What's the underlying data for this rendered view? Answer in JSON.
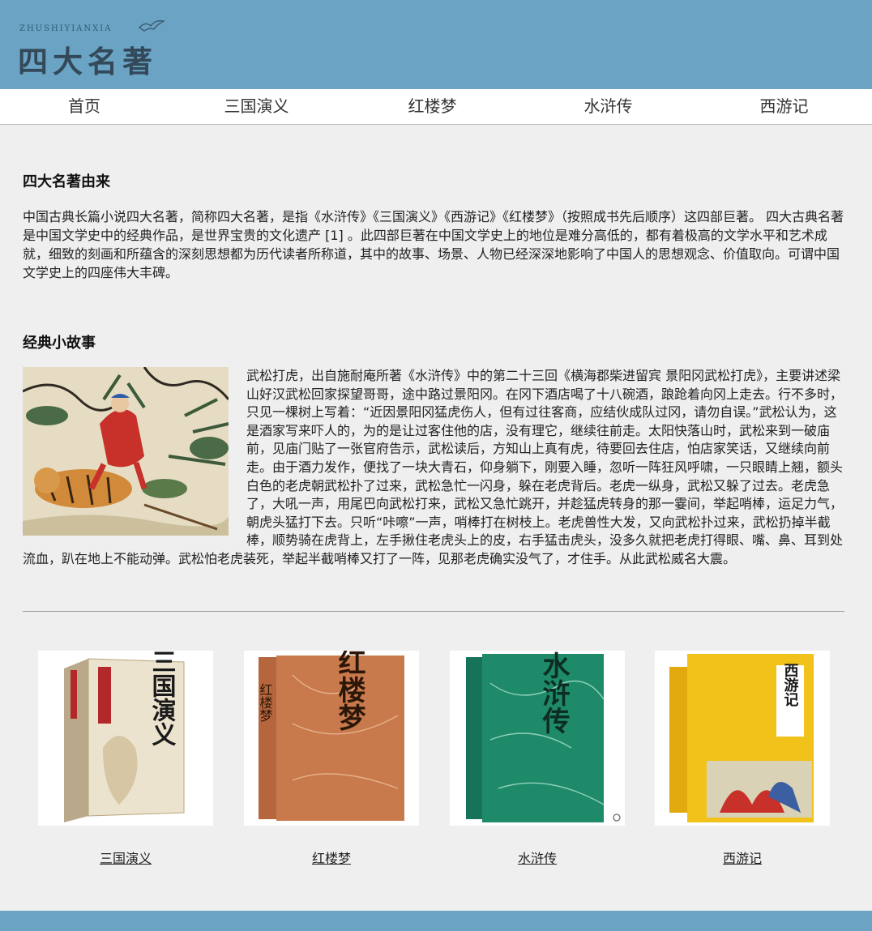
{
  "header": {
    "logo_sub": "ZHUSHIYIANXIA",
    "logo_title": "四大名著"
  },
  "nav": [
    {
      "label": "首页"
    },
    {
      "label": "三国演义"
    },
    {
      "label": "红楼梦"
    },
    {
      "label": "水浒传"
    },
    {
      "label": "西游记"
    }
  ],
  "intro": {
    "title": "四大名著由来",
    "text": "中国古典长篇小说四大名著，简称四大名著，是指《水浒传》《三国演义》《西游记》《红楼梦》（按照成书先后顺序）这四部巨著。 四大古典名著是中国文学史中的经典作品，是世界宝贵的文化遗产 [1] 。此四部巨著在中国文学史上的地位是难分高低的，都有着极高的文学水平和艺术成就，细致的刻画和所蕴含的深刻思想都为历代读者所称道，其中的故事、场景、人物已经深深地影响了中国人的思想观念、价值取向。可谓中国文学史上的四座伟大丰碑。"
  },
  "story": {
    "title": "经典小故事",
    "text": "武松打虎，出自施耐庵所著《水浒传》中的第二十三回《横海郡柴进留宾 景阳冈武松打虎》，主要讲述梁山好汉武松回家探望哥哥，途中路过景阳冈。在冈下酒店喝了十八碗酒，踉跄着向冈上走去。行不多时，只见一棵树上写着：“近因景阳冈猛虎伤人，但有过往客商，应结伙成队过冈，请勿自误。”武松认为，这是酒家写来吓人的，为的是让过客住他的店，没有理它，继续往前走。太阳快落山时，武松来到一破庙前，见庙门贴了一张官府告示，武松读后，方知山上真有虎，待要回去住店，怕店家笑话，又继续向前走。由于酒力发作，便找了一块大青石，仰身躺下，刚要入睡，忽听一阵狂风呼啸，一只眼睛上翘，额头白色的老虎朝武松扑了过来，武松急忙一闪身，躲在老虎背后。老虎一纵身，武松又躲了过去。老虎急了，大吼一声，用尾巴向武松打来，武松又急忙跳开，并趁猛虎转身的那一霎间，举起哨棒，运足力气，朝虎头猛打下去。只听“咔嚓”一声，哨棒打在树枝上。老虎兽性大发，又向武松扑过来，武松扔掉半截棒，顺势骑在虎背上，左手揪住老虎头上的皮，右手猛击虎头，没多久就把老虎打得眼、嘴、鼻、耳到处流血，趴在地上不能动弹。武松怕老虎装死，举起半截哨棒又打了一阵，见那老虎确实没气了，才住手。从此武松威名大震。"
  },
  "books": [
    {
      "label": "三国演义",
      "cover_text": "三国演义",
      "cover_color": "#ece3cf"
    },
    {
      "label": "红楼梦",
      "cover_text": "红楼梦",
      "cover_color": "#c97a4d"
    },
    {
      "label": "水浒传",
      "cover_text": "水浒传",
      "cover_color": "#1f8a6a"
    },
    {
      "label": "西游记",
      "cover_text": "西游记",
      "cover_color": "#f1c21a"
    }
  ],
  "colors": {
    "header_bg": "#6aa3c4",
    "page_bg": "#efefef",
    "nav_bg": "#ffffff"
  }
}
